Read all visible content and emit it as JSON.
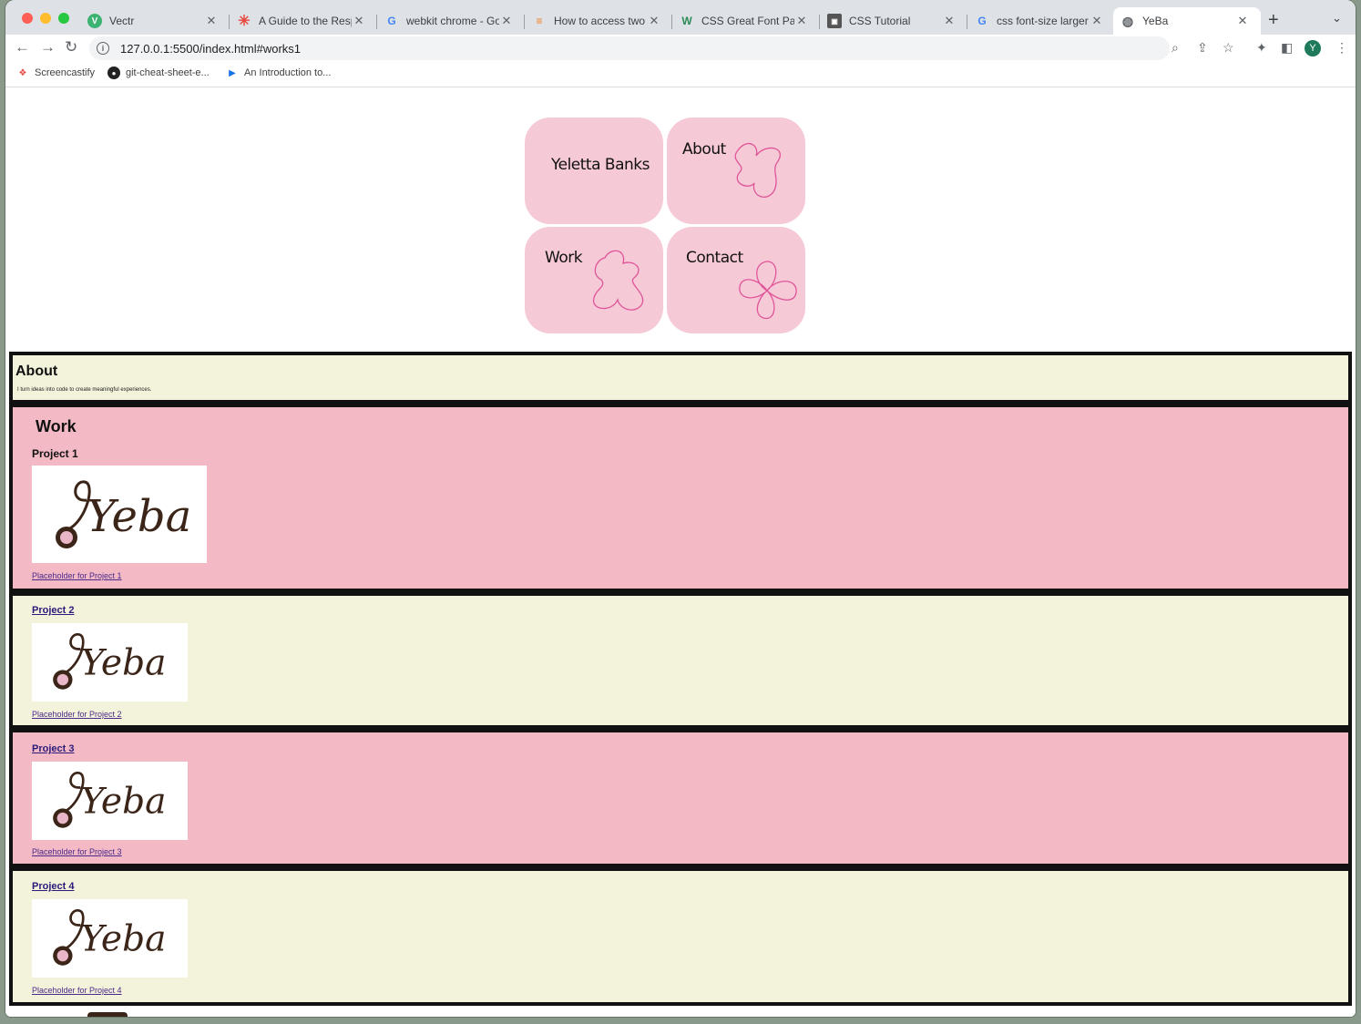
{
  "browser": {
    "tabs": [
      {
        "title": "Vectr",
        "icon": "vectr-icon",
        "active": false
      },
      {
        "title": "A Guide to the Respon",
        "icon": "asterisk-icon",
        "active": false
      },
      {
        "title": "webkit chrome - Goog",
        "icon": "google-icon",
        "active": false
      },
      {
        "title": "How to access two Ide",
        "icon": "stackoverflow-icon",
        "active": false
      },
      {
        "title": "CSS Great Font Pairing",
        "icon": "w-icon",
        "active": false
      },
      {
        "title": "CSS Tutorial",
        "icon": "css-icon",
        "active": false
      },
      {
        "title": "css font-size larger - (",
        "icon": "google-icon",
        "active": false
      },
      {
        "title": "YeBa",
        "icon": "globe-icon",
        "active": true
      }
    ],
    "url": "127.0.0.1:5500/index.html#works1",
    "avatar_letter": "Y",
    "bookmarks": [
      {
        "label": "Screencastify",
        "icon": "screencastify-icon"
      },
      {
        "label": "git-cheat-sheet-e...",
        "icon": "github-icon"
      },
      {
        "label": "An Introduction to...",
        "icon": "play-icon"
      }
    ]
  },
  "nav": {
    "name": "Yeletta Banks",
    "about": "About",
    "work": "Work",
    "contact": "Contact"
  },
  "about": {
    "heading": "About",
    "text": "I turn ideas into code to create meaningful experiences."
  },
  "work": {
    "heading": "Work",
    "projects": [
      {
        "title": "Project 1",
        "link": "Placeholder for Project 1",
        "logo_text": "Yeba"
      },
      {
        "title": "Project 2",
        "link": "Placeholder for Project 2",
        "logo_text": "Yeba"
      },
      {
        "title": "Project 3",
        "link": "Placeholder for Project 3",
        "logo_text": "Yeba"
      },
      {
        "title": "Project 4",
        "link": "Placeholder for Project 4",
        "logo_text": "Yeba"
      }
    ]
  },
  "colors": {
    "tile_pink": "#f5c9d6",
    "section_cream": "#f3f2da",
    "section_pink": "#f3bac6",
    "flower_stroke": "#e0559a"
  }
}
